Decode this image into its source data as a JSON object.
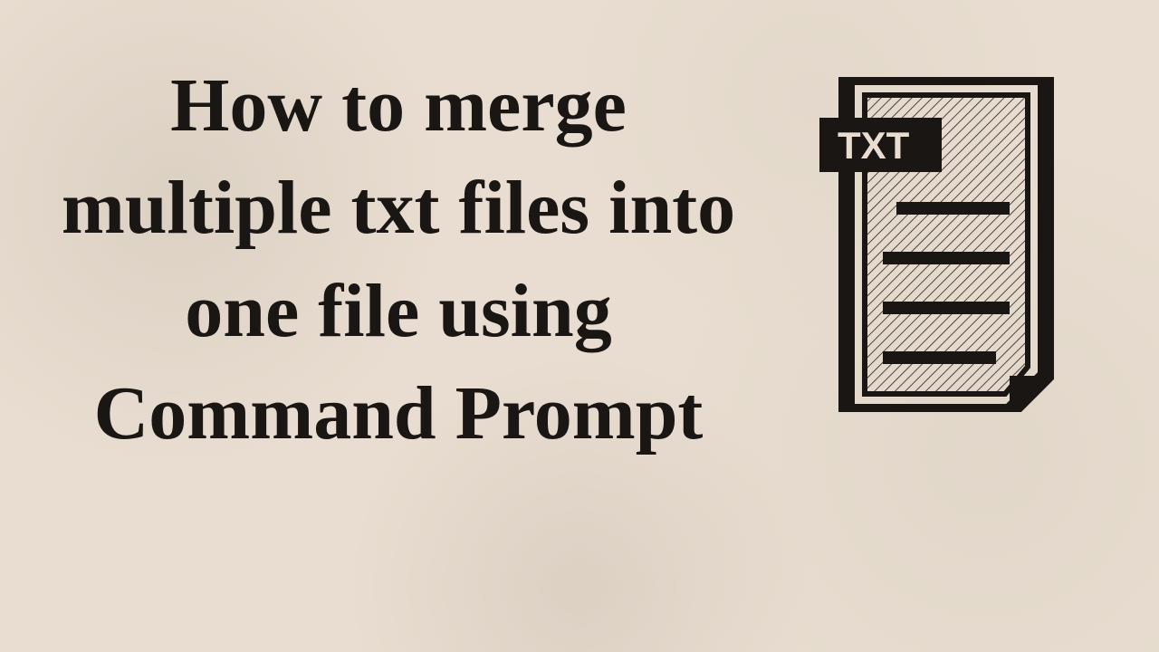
{
  "title": "How to merge multiple txt files into one file using Command Prompt",
  "icon": {
    "label": "TXT",
    "name": "txt-file-icon"
  }
}
